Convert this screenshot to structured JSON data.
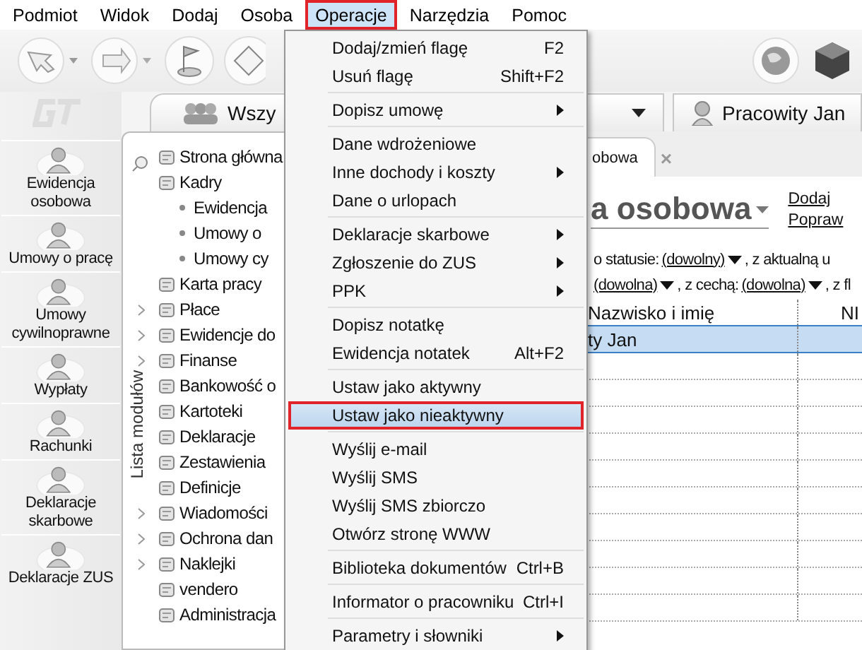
{
  "menubar": [
    {
      "label": "Podmiot",
      "selected": false
    },
    {
      "label": "Widok",
      "selected": false
    },
    {
      "label": "Dodaj",
      "selected": false
    },
    {
      "label": "Osoba",
      "selected": false
    },
    {
      "label": "Operacje",
      "selected": true
    },
    {
      "label": "Narzędzia",
      "selected": false
    },
    {
      "label": "Pomoc",
      "selected": false
    }
  ],
  "sidebar": {
    "items": [
      {
        "label": "Ewidencja osobowa"
      },
      {
        "label": "Umowy o pracę"
      },
      {
        "label": "Umowy cywilnoprawne"
      },
      {
        "label": "Wypłaty"
      },
      {
        "label": "Rachunki"
      },
      {
        "label": "Deklaracje skarbowe"
      },
      {
        "label": "Deklaracje ZUS"
      }
    ]
  },
  "tabs": [
    {
      "label": "Wszy",
      "kind": "group"
    },
    {
      "label": "Pracowity Jan",
      "kind": "person"
    }
  ],
  "module_panel": {
    "title": "Lista modułów",
    "items": [
      {
        "label": "Strona główna",
        "expandable": false
      },
      {
        "label": "Kadry",
        "expandable": false,
        "children": [
          {
            "label": "Ewidencja"
          },
          {
            "label": "Umowy o"
          },
          {
            "label": "Umowy cy"
          }
        ]
      },
      {
        "label": "Karta pracy",
        "expandable": false
      },
      {
        "label": "Płace",
        "expandable": true
      },
      {
        "label": "Ewidencje do",
        "expandable": true
      },
      {
        "label": "Finanse",
        "expandable": true
      },
      {
        "label": "Bankowość o",
        "expandable": false
      },
      {
        "label": "Kartoteki",
        "expandable": false
      },
      {
        "label": "Deklaracje",
        "expandable": false
      },
      {
        "label": "Zestawienia",
        "expandable": false
      },
      {
        "label": "Definicje",
        "expandable": false
      },
      {
        "label": "Wiadomości",
        "expandable": true
      },
      {
        "label": "Ochrona dan",
        "expandable": true
      },
      {
        "label": "Naklejki",
        "expandable": true
      },
      {
        "label": "vendero",
        "expandable": false
      },
      {
        "label": "Administracja",
        "expandable": false
      }
    ]
  },
  "document": {
    "tab": "obowa",
    "close_symbol": "×",
    "title": "a osobowa",
    "actions": [
      "Dodaj",
      "Popraw"
    ],
    "filters": [
      [
        {
          "kind": "text",
          "text": "o statusie:"
        },
        {
          "kind": "dropdown",
          "text": "(dowolny)"
        },
        {
          "kind": "text",
          "text": ", z aktualną u"
        }
      ],
      [
        {
          "kind": "dropdown",
          "text": "(dowolna)"
        },
        {
          "kind": "text",
          "text": ", z cechą:"
        },
        {
          "kind": "dropdown",
          "text": "(dowolna)"
        },
        {
          "kind": "text",
          "text": ", z fl"
        }
      ]
    ],
    "table": {
      "columns": [
        "Nazwisko i imię",
        "NI"
      ],
      "rows": [
        {
          "cells": [
            "ty Jan"
          ],
          "selected": true
        }
      ]
    }
  },
  "menu": {
    "groups": [
      [
        {
          "label": "Dodaj/zmień flagę",
          "shortcut": "F2",
          "submenu": false,
          "selected": false
        },
        {
          "label": "Usuń flagę",
          "shortcut": "Shift+F2",
          "submenu": false,
          "selected": false
        }
      ],
      [
        {
          "label": "Dopisz umowę",
          "submenu": true,
          "selected": false
        }
      ],
      [
        {
          "label": "Dane wdrożeniowe",
          "submenu": false,
          "selected": false
        },
        {
          "label": "Inne dochody i koszty",
          "submenu": true,
          "selected": false
        },
        {
          "label": "Dane o urlopach",
          "submenu": false,
          "selected": false
        }
      ],
      [
        {
          "label": "Deklaracje skarbowe",
          "submenu": true,
          "selected": false
        },
        {
          "label": "Zgłoszenie do ZUS",
          "submenu": true,
          "selected": false
        },
        {
          "label": "PPK",
          "submenu": true,
          "selected": false
        }
      ],
      [
        {
          "label": "Dopisz notatkę",
          "submenu": false,
          "selected": false
        },
        {
          "label": "Ewidencja notatek",
          "shortcut": "Alt+F2",
          "submenu": false,
          "selected": false
        }
      ],
      [
        {
          "label": "Ustaw jako aktywny",
          "submenu": false,
          "selected": false
        },
        {
          "label": "Ustaw jako nieaktywny",
          "submenu": false,
          "selected": true
        }
      ],
      [
        {
          "label": "Wyślij e-mail",
          "submenu": false,
          "selected": false
        },
        {
          "label": "Wyślij SMS",
          "submenu": false,
          "selected": false
        },
        {
          "label": "Wyślij SMS zbiorczo",
          "submenu": false,
          "selected": false
        },
        {
          "label": "Otwórz stronę WWW",
          "submenu": false,
          "selected": false
        }
      ],
      [
        {
          "label": "Biblioteka dokumentów",
          "shortcut": "Ctrl+B",
          "submenu": false,
          "selected": false
        }
      ],
      [
        {
          "label": "Informator o pracowniku",
          "shortcut": "Ctrl+I",
          "submenu": false,
          "selected": false
        }
      ],
      [
        {
          "label": "Parametry i słowniki",
          "submenu": true,
          "selected": false
        }
      ]
    ]
  }
}
